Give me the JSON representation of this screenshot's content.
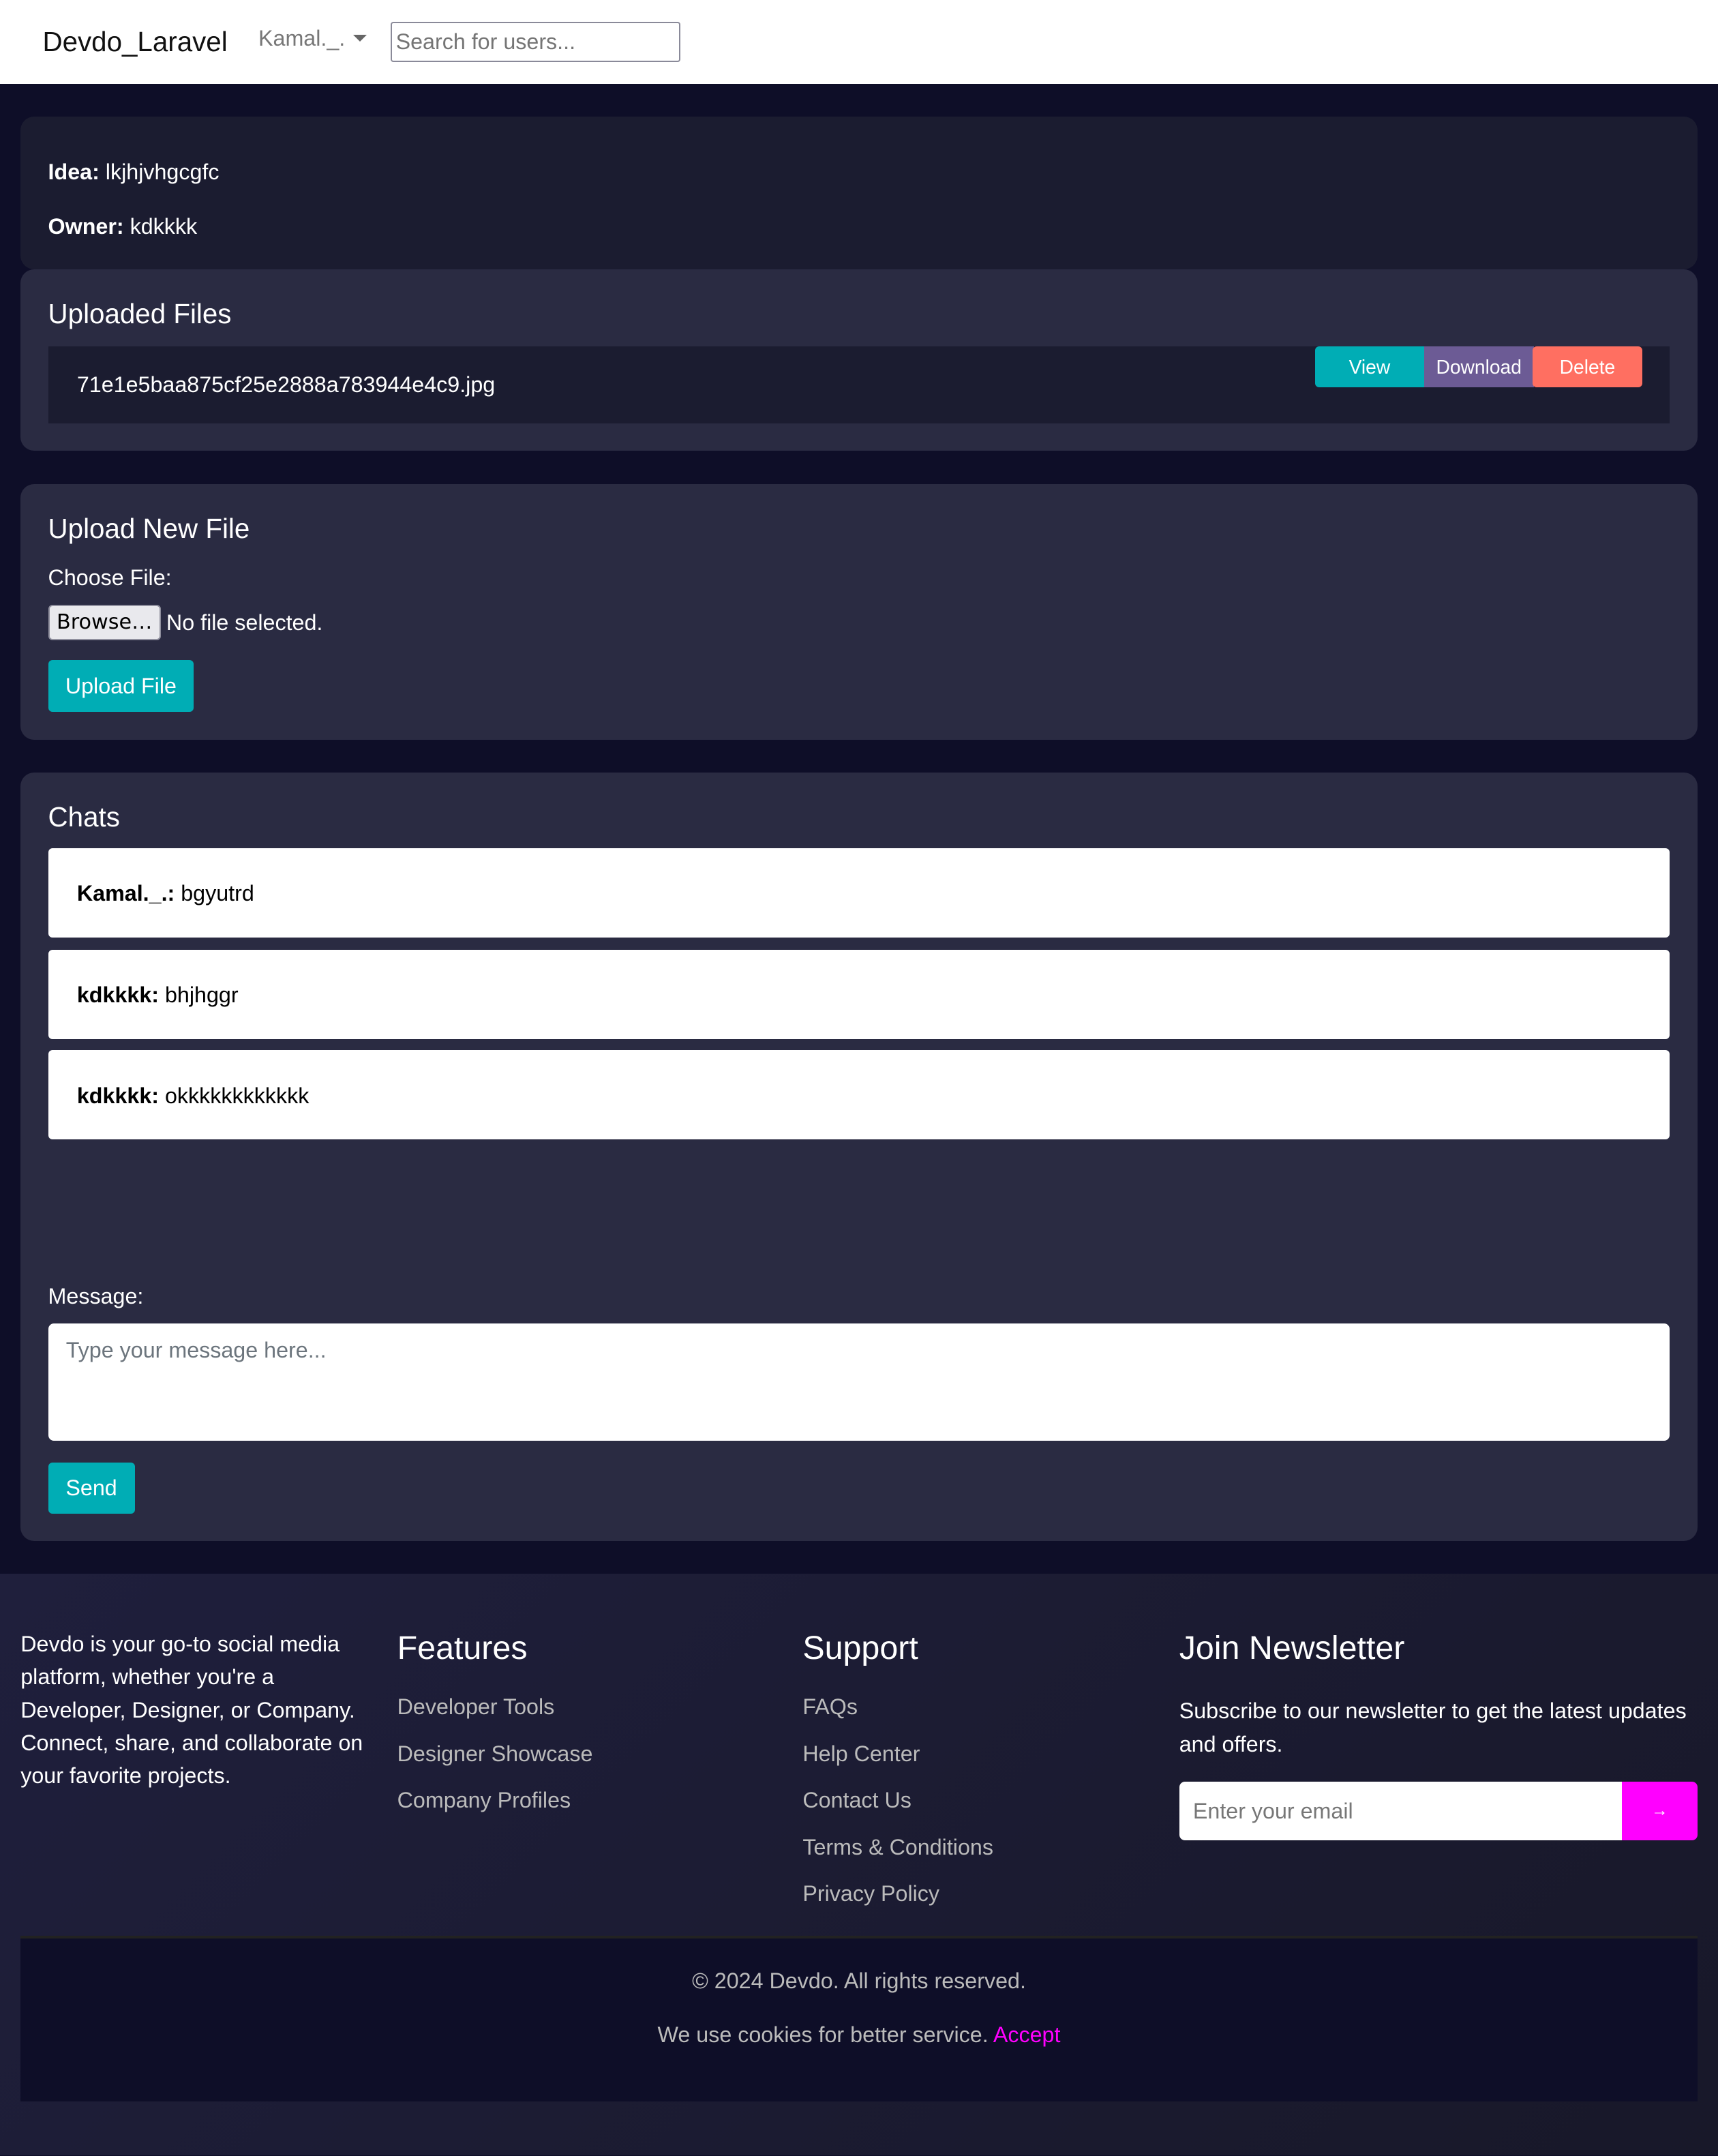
{
  "nav": {
    "brand": "Devdo_Laravel",
    "user": "Kamal._.",
    "search_placeholder": "Search for users..."
  },
  "idea": {
    "idea_label": "Idea:",
    "idea_value": "lkjhjvhgcgfc",
    "owner_label": "Owner:",
    "owner_value": "kdkkkk"
  },
  "files": {
    "title": "Uploaded Files",
    "items": [
      {
        "name": "71e1e5baa875cf25e2888a783944e4c9.jpg",
        "view": "View",
        "download": "Download",
        "delete": "Delete"
      }
    ]
  },
  "upload": {
    "title": "Upload New File",
    "choose_label": "Choose File:",
    "browse": "Browse…",
    "no_file": "No file selected.",
    "submit": "Upload File"
  },
  "chats": {
    "title": "Chats",
    "messages": [
      {
        "user": "Kamal._.:",
        "text": "bgyutrd"
      },
      {
        "user": "kdkkkk:",
        "text": "bhjhggr"
      },
      {
        "user": "kdkkkk:",
        "text": "okkkkkkkkkkkk"
      }
    ],
    "message_label": "Message:",
    "placeholder": "Type your message here...",
    "send": "Send"
  },
  "footer": {
    "about": "Devdo is your go-to social media platform, whether you're a Developer, Designer, or Company. Connect, share, and collaborate on your favorite projects.",
    "features_title": "Features",
    "features": [
      "Developer Tools",
      "Designer Showcase",
      "Company Profiles"
    ],
    "support_title": "Support",
    "support": [
      "FAQs",
      "Help Center",
      "Contact Us",
      "Terms & Conditions",
      "Privacy Policy"
    ],
    "newsletter_title": "Join Newsletter",
    "newsletter_text": "Subscribe to our newsletter to get the latest updates and offers.",
    "email_placeholder": "Enter your email",
    "submit_icon": "→",
    "copyright": "© 2024 Devdo. All rights reserved.",
    "cookies": "We use cookies for better service.",
    "accept": "Accept"
  },
  "colors": {
    "teal": "#00adb5",
    "purple": "#6c5b95",
    "coral": "#ff6f61",
    "magenta": "#ff00ff"
  }
}
